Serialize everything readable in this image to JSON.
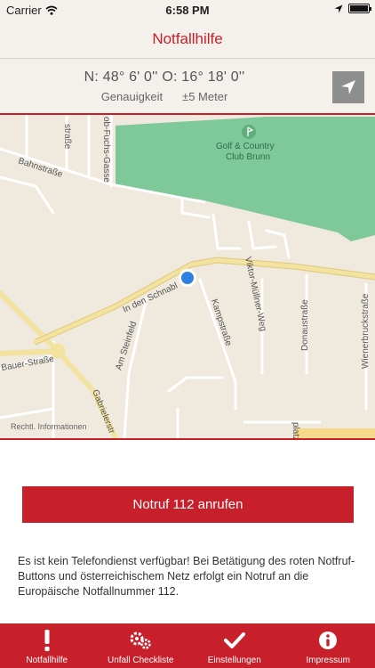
{
  "status_bar": {
    "carrier": "Carrier",
    "time": "6:58 PM"
  },
  "header": {
    "title": "Notfallhilfe"
  },
  "coordinates": {
    "position": "N: 48° 6' 0'' O: 16° 18' 0''",
    "accuracy_label": "Genauigkeit",
    "accuracy_value": "±5 Meter"
  },
  "map": {
    "labels": {
      "golf": "Golf & Country",
      "golf2": "Club Brunn",
      "bahnstrasse": "Bahnstraße",
      "fuchs": "ob-Fuchs-Gasse",
      "strasse_top": "straße",
      "schnabl": "In den Schnabl",
      "steinfeld": "Am Steinfeld",
      "kamp": "Kampstraße",
      "muellner": "Viktor-Müllner-Weg",
      "donau": "Donaustraße",
      "wiener": "Wienerbruckstraße",
      "bauer": "Bauer-Straße",
      "gabriel": "Gabrielerstr",
      "platz": "platz"
    },
    "legal": "Rechtl. Informationen"
  },
  "call_button": {
    "label": "Notruf 112 anrufen"
  },
  "info_text": "Es ist kein Telefondienst verfügbar! Bei Betätigung des roten Notfruf-Buttons und österreichischem Netz erfolgt ein Notruf an die Europäische Notfallnummer 112.",
  "tabs": [
    {
      "label": "Notfallhilfe",
      "icon": "exclamation-icon"
    },
    {
      "label": "Unfall Checkliste",
      "icon": "gears-icon"
    },
    {
      "label": "Einstellungen",
      "icon": "checkmark-icon"
    },
    {
      "label": "Impressum",
      "icon": "info-icon"
    }
  ],
  "colors": {
    "accent": "#c8202a",
    "map_park": "#7fc89a",
    "location_dot": "#2d7fe0"
  }
}
